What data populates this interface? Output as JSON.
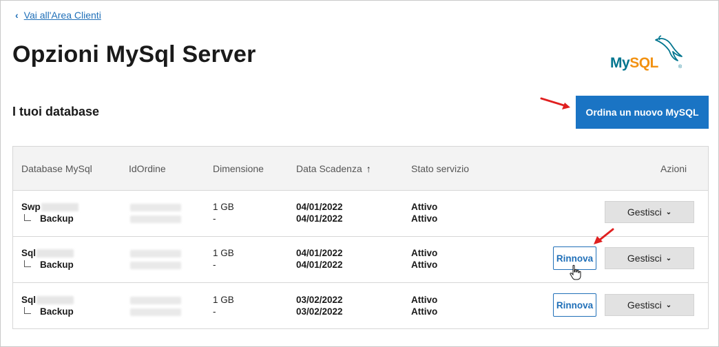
{
  "nav": {
    "back_label": "Vai all'Area Clienti",
    "back_icon": "chevron-left-icon"
  },
  "page": {
    "title": "Opzioni MySql Server"
  },
  "logo": {
    "my": "My",
    "sql": "SQL",
    "reg": "®",
    "icon": "dolphin-icon"
  },
  "section": {
    "title": "I tuoi database",
    "order_button": "Ordina un nuovo MySQL"
  },
  "table": {
    "headers": {
      "database": "Database MySql",
      "id_ordine": "IdOrdine",
      "dimensione": "Dimensione",
      "data_scadenza": "Data Scadenza",
      "sort_icon": "↑",
      "stato": "Stato servizio",
      "azioni": "Azioni"
    },
    "rows": [
      {
        "name": "Swp",
        "backup_label": "Backup",
        "size": "1 GB",
        "backup_size": "-",
        "date": "04/01/2022",
        "backup_date": "04/01/2022",
        "status": "Attivo",
        "backup_status": "Attivo",
        "renew": "",
        "manage": "Gestisci"
      },
      {
        "name": "Sql",
        "backup_label": "Backup",
        "size": "1 GB",
        "backup_size": "-",
        "date": "04/01/2022",
        "backup_date": "04/01/2022",
        "status": "Attivo",
        "backup_status": "Attivo",
        "renew": "Rinnova",
        "manage": "Gestisci"
      },
      {
        "name": "Sql",
        "backup_label": "Backup",
        "size": "1 GB",
        "backup_size": "-",
        "date": "03/02/2022",
        "backup_date": "03/02/2022",
        "status": "Attivo",
        "backup_status": "Attivo",
        "renew": "Rinnova",
        "manage": "Gestisci"
      }
    ]
  },
  "colors": {
    "accent": "#1a74c4",
    "link": "#1f6fb8",
    "arrow": "#e02020",
    "mysql_blue": "#00758f",
    "mysql_orange": "#f29111"
  }
}
